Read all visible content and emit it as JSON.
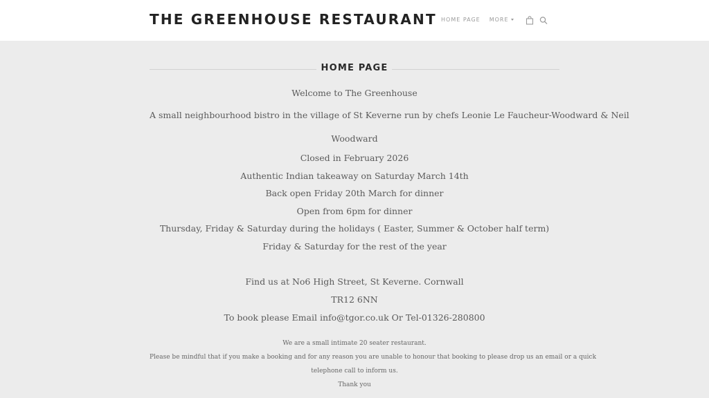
{
  "header": {
    "site_title": "THE GREENHOUSE RESTAURANT",
    "nav": {
      "home": "HOME PAGE",
      "more": "MORE"
    },
    "icons": [
      "bag-icon",
      "search-icon"
    ]
  },
  "page": {
    "heading": "HOME PAGE",
    "lines": [
      "Welcome to The Greenhouse",
      "A small neighbourhood bistro in the village of St Keverne run by chefs Leonie Le Faucheur-Woodward  & Neil",
      "Woodward",
      "Closed in February 2026",
      "Authentic Indian takeaway on Saturday March 14th",
      "Back open Friday 20th March for dinner",
      "Open from 6pm for dinner",
      "Thursday, Friday & Saturday during the holidays ( Easter, Summer & October half term)",
      "Friday & Saturday for the rest of the year",
      "Find us at No6 High Street, St Keverne. Cornwall",
      "TR12 6NN",
      "To book please Email  info@tgor.co.uk  Or  Tel-01326-280800"
    ],
    "notes": [
      "We are a small intimate 20 seater restaurant.",
      "Please be mindful that if you make a booking and for any reason you are unable to honour that booking to please drop us an email or a quick",
      "telephone call to inform us.",
      "Thank you"
    ]
  }
}
